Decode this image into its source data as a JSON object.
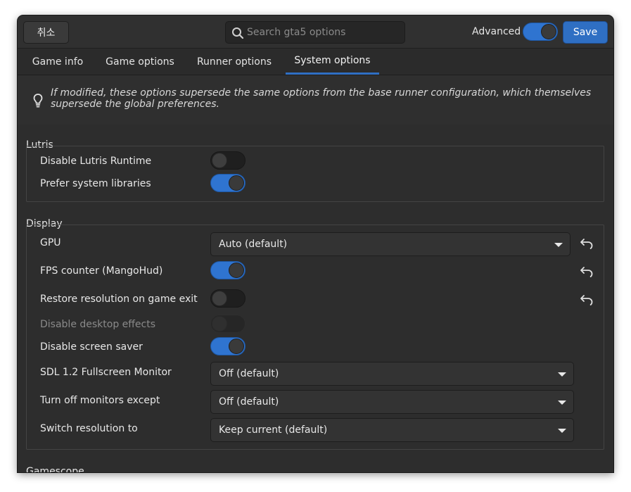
{
  "header": {
    "cancel_label": "취소",
    "search_placeholder": "Search gta5 options",
    "search_value": "",
    "advanced_label": "Advanced",
    "advanced_on": true,
    "save_label": "Save"
  },
  "tabs": [
    {
      "label": "Game info",
      "active": false
    },
    {
      "label": "Game options",
      "active": false
    },
    {
      "label": "Runner options",
      "active": false
    },
    {
      "label": "System options",
      "active": true
    }
  ],
  "info": {
    "text": "If modified, these options supersede the same options from the base runner configuration, which themselves supersede the global preferences.",
    "icon": "lightbulb-icon"
  },
  "sections": {
    "lutris": {
      "title": "Lutris",
      "options": [
        {
          "label": "Disable Lutris Runtime",
          "type": "switch",
          "on": false
        },
        {
          "label": "Prefer system libraries",
          "type": "switch",
          "on": true
        }
      ]
    },
    "display": {
      "title": "Display",
      "options": [
        {
          "label": "GPU",
          "type": "dropdown",
          "value": "Auto (default)",
          "reset": true
        },
        {
          "label": "FPS counter (MangoHud)",
          "type": "switch",
          "on": true,
          "reset": true
        },
        {
          "label": "Restore resolution on game exit",
          "type": "switch",
          "on": false,
          "reset": true
        },
        {
          "label": "Disable desktop effects",
          "type": "switch",
          "on": false,
          "disabled": true
        },
        {
          "label": "Disable screen saver",
          "type": "switch",
          "on": true
        },
        {
          "label": "SDL 1.2 Fullscreen Monitor",
          "type": "dropdown",
          "value": "Off (default)"
        },
        {
          "label": "Turn off monitors except",
          "type": "dropdown",
          "value": "Off (default)"
        },
        {
          "label": "Switch resolution to",
          "type": "dropdown",
          "value": "Keep current (default)"
        }
      ]
    },
    "next": {
      "title": "Gamescope"
    }
  },
  "colors": {
    "accent": "#2f6fc3",
    "background": "#2d2d2d"
  }
}
